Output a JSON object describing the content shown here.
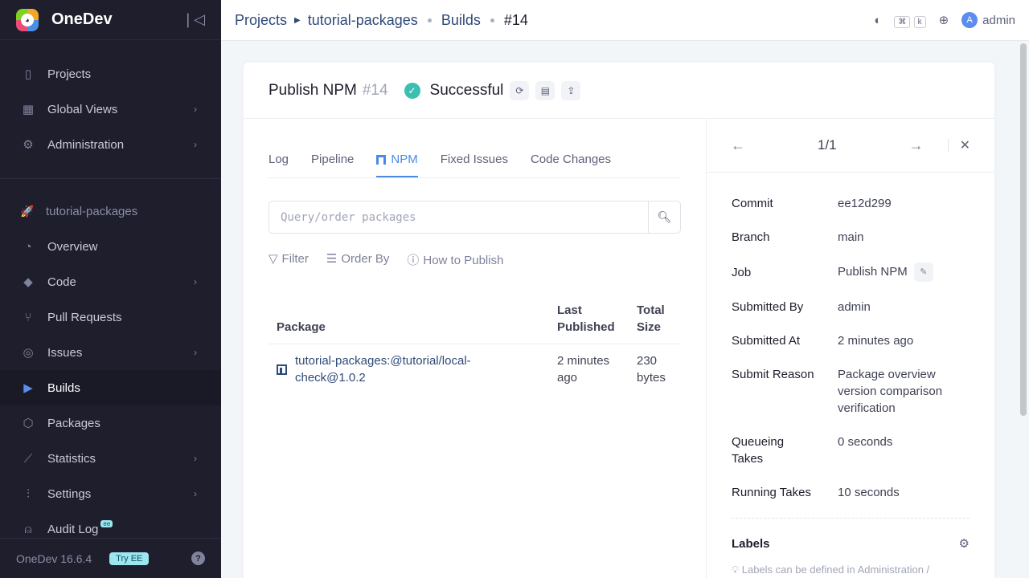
{
  "app": {
    "name": "OneDev",
    "version": "OneDev 16.6.4",
    "try_ee": "Try EE",
    "help": "?"
  },
  "sidebar": {
    "global_items": [
      {
        "label": "Projects",
        "icon": "projects-icon",
        "chevron": false
      },
      {
        "label": "Global Views",
        "icon": "grid-icon",
        "chevron": true
      },
      {
        "label": "Administration",
        "icon": "gear-icon",
        "chevron": true
      }
    ],
    "project_name": "tutorial-packages",
    "project_items": [
      {
        "label": "Overview",
        "icon": "dashboard-icon",
        "chevron": false
      },
      {
        "label": "Code",
        "icon": "code-icon",
        "chevron": true
      },
      {
        "label": "Pull Requests",
        "icon": "pull-request-icon",
        "chevron": false
      },
      {
        "label": "Issues",
        "icon": "issue-icon",
        "chevron": true
      },
      {
        "label": "Builds",
        "icon": "play-icon",
        "chevron": false,
        "active": true
      },
      {
        "label": "Packages",
        "icon": "package-icon",
        "chevron": false
      },
      {
        "label": "Statistics",
        "icon": "chart-icon",
        "chevron": true
      },
      {
        "label": "Settings",
        "icon": "sliders-icon",
        "chevron": true
      },
      {
        "label": "Audit Log",
        "icon": "user-icon",
        "chevron": false,
        "ee": "ee"
      }
    ]
  },
  "breadcrumb": {
    "projects": "Projects",
    "project": "tutorial-packages",
    "builds": "Builds",
    "current": "#14"
  },
  "topbar": {
    "user": "admin",
    "avatar_letter": "A",
    "kbd1": "⌘",
    "kbd2": "k"
  },
  "build": {
    "job": "Publish NPM",
    "number": "#14",
    "status": "Successful",
    "status_color": "#3bbfb0"
  },
  "tabs": [
    "Log",
    "Pipeline",
    "NPM",
    "Fixed Issues",
    "Code Changes"
  ],
  "search": {
    "placeholder": "Query/order packages"
  },
  "tools": {
    "filter": "Filter",
    "order_by": "Order By",
    "how_to": "How to Publish"
  },
  "table": {
    "headers": {
      "package": "Package",
      "last_published": "Last Published",
      "total_size": "Total Size"
    },
    "rows": [
      {
        "package": "tutorial-packages:@tutorial/local-check@1.0.2",
        "last_published": "2 minutes ago",
        "total_size": "230 bytes"
      }
    ]
  },
  "pager": {
    "count": "1/1"
  },
  "props": [
    {
      "key": "Commit",
      "value": "ee12d299"
    },
    {
      "key": "Branch",
      "value": "main"
    },
    {
      "key": "Job",
      "value": "Publish NPM"
    },
    {
      "key": "Submitted By",
      "value": "admin"
    },
    {
      "key": "Submitted At",
      "value": "2 minutes ago"
    },
    {
      "key": "Submit Reason",
      "value": "Package overview version comparison verification"
    },
    {
      "key": "Queueing Takes",
      "value": "0 seconds"
    },
    {
      "key": "Running Takes",
      "value": "10 seconds"
    }
  ],
  "labels": {
    "title": "Labels",
    "hint": "Labels can be defined in Administration /"
  },
  "colors": {
    "accent": "#4a8ae5",
    "sidebar_bg": "#1e1e2d",
    "success": "#3bbfb0"
  }
}
